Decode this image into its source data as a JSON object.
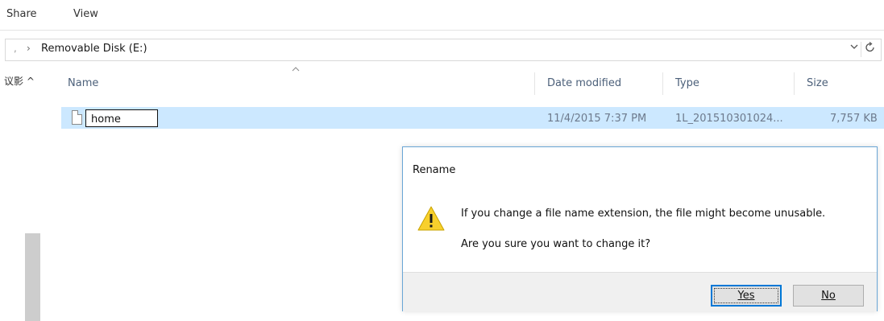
{
  "ribbon": {
    "tabs": [
      {
        "label": "Share"
      },
      {
        "label": "View"
      }
    ]
  },
  "address": {
    "path": "Removable Disk (E:)",
    "separator_glyph": "›",
    "dropdown_icon": "chevron-down-icon",
    "refresh_icon": "refresh-icon"
  },
  "nav_pane": {
    "label_fragment": "议影 ^"
  },
  "columns": {
    "name": "Name",
    "date_modified": "Date modified",
    "type": "Type",
    "size": "Size"
  },
  "file": {
    "name": "home",
    "date_modified": "11/4/2015 7:37 PM",
    "type": "1L_201510301024...",
    "size": "7,757 KB",
    "icon": "file-icon"
  },
  "dialog": {
    "title": "Rename",
    "message_1": "If you change a file name extension, the file might become unusable.",
    "message_2": "Are you sure you want to change it?",
    "yes_button": "Yes",
    "no_button": "No",
    "icon": "warning-icon"
  },
  "colors": {
    "selection": "#cce8ff",
    "accent": "#0078d7",
    "column_header_text": "#4c607a"
  }
}
